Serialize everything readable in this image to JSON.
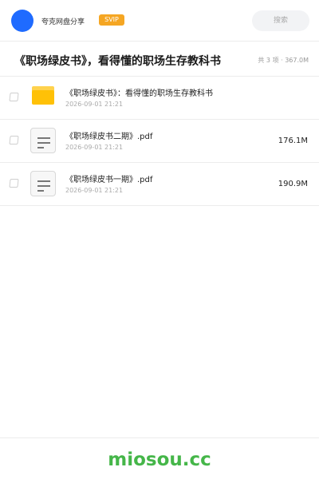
{
  "header": {
    "brand": "夸克网盘分享",
    "badge": "SVIP",
    "search_placeholder": "搜索"
  },
  "share": {
    "title": "《职场绿皮书》，看得懂的职场生存教科书",
    "summary": "共 3 项 · 367.0M"
  },
  "files": [
    {
      "icon": "folder-icon",
      "name": "《职场绿皮书》：看得懂的职场生存教科书",
      "date": "2026-09-01 21:21",
      "size": ""
    },
    {
      "icon": "document-icon",
      "name": "《职场绿皮书二期》.pdf",
      "date": "2026-09-01 21:21",
      "size": "176.1M"
    },
    {
      "icon": "document-icon",
      "name": "《职场绿皮书一期》.pdf",
      "date": "2026-09-01 21:21",
      "size": "190.9M"
    }
  ],
  "footer": {
    "watermark": "miosou.cc"
  },
  "colors": {
    "avatar": "#1f6bff",
    "badge": "#f5a623",
    "folder": "#ffc107",
    "watermark": "#45b649"
  }
}
